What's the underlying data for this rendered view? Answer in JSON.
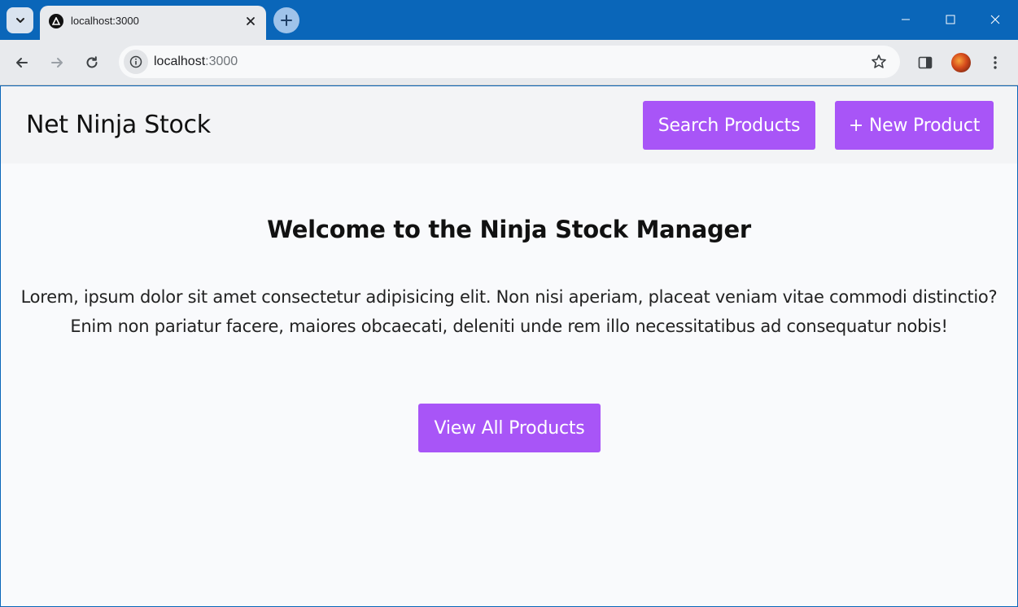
{
  "browser": {
    "tab_title": "localhost:3000",
    "url_host": "localhost",
    "url_port": ":3000"
  },
  "app": {
    "brand": "Net Ninja Stock",
    "nav": {
      "search_label": "Search Products",
      "new_label": "+ New Product"
    },
    "hero": {
      "title": "Welcome to the Ninja Stock Manager",
      "body": "Lorem, ipsum dolor sit amet consectetur adipisicing elit. Non nisi aperiam, placeat veniam vitae commodi distinctio? Enim non pariatur facere, maiores obcaecati, deleniti unde rem illo necessitatibus ad consequatur nobis!",
      "cta_label": "View All Products"
    }
  },
  "colors": {
    "accent": "#a855f7",
    "titlebar": "#0a66b9",
    "header_bg": "#f3f4f6",
    "page_bg": "#f9fafc"
  },
  "icons": [
    "tab-search-icon",
    "site-favicon-icon",
    "close-icon",
    "plus-icon",
    "minimize-icon",
    "maximize-icon",
    "window-close-icon",
    "back-arrow-icon",
    "forward-arrow-icon",
    "reload-icon",
    "info-icon",
    "star-icon",
    "side-panel-icon",
    "profile-avatar",
    "kebab-menu-icon"
  ]
}
